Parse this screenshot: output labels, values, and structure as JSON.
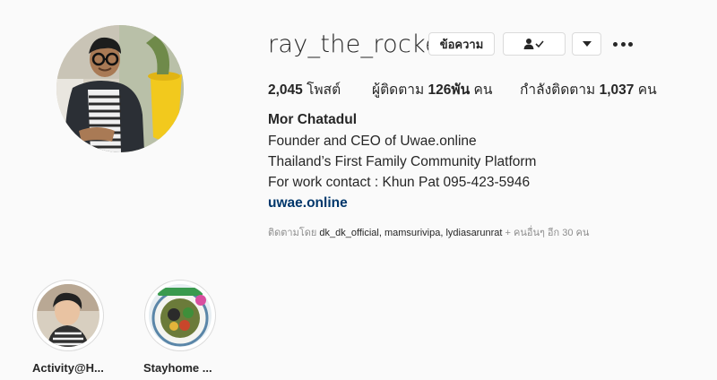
{
  "profile": {
    "username": "ray_the_rocket",
    "message_button": "ข้อความ",
    "following_icon": "person-check-icon",
    "dropdown_icon": "caret-down-icon",
    "more_icon": "ellipsis-icon"
  },
  "stats": {
    "posts_count": "2,045",
    "posts_label": "โพสต์",
    "followers_prefix": "ผู้ติดตาม",
    "followers_count": "126พัน",
    "followers_suffix": "คน",
    "following_prefix": "กำลังติดตาม",
    "following_count": "1,037",
    "following_suffix": "คน"
  },
  "bio": {
    "name": "Mor Chatadul",
    "line1": "Founder and CEO of Uwae.online",
    "line2": "Thailand’s First Family Community Platform",
    "line3": "For work contact : Khun Pat 095-423-5946",
    "link": "uwae.online"
  },
  "followed_by": {
    "prefix": "ติดตามโดย",
    "users": "dk_dk_official, mamsurivipa, lydiasarunrat",
    "suffix": "+ คนอื่นๆ อีก 30 คน"
  },
  "highlights": [
    {
      "label": "Activity@H..."
    },
    {
      "label": "Stayhome ..."
    }
  ]
}
